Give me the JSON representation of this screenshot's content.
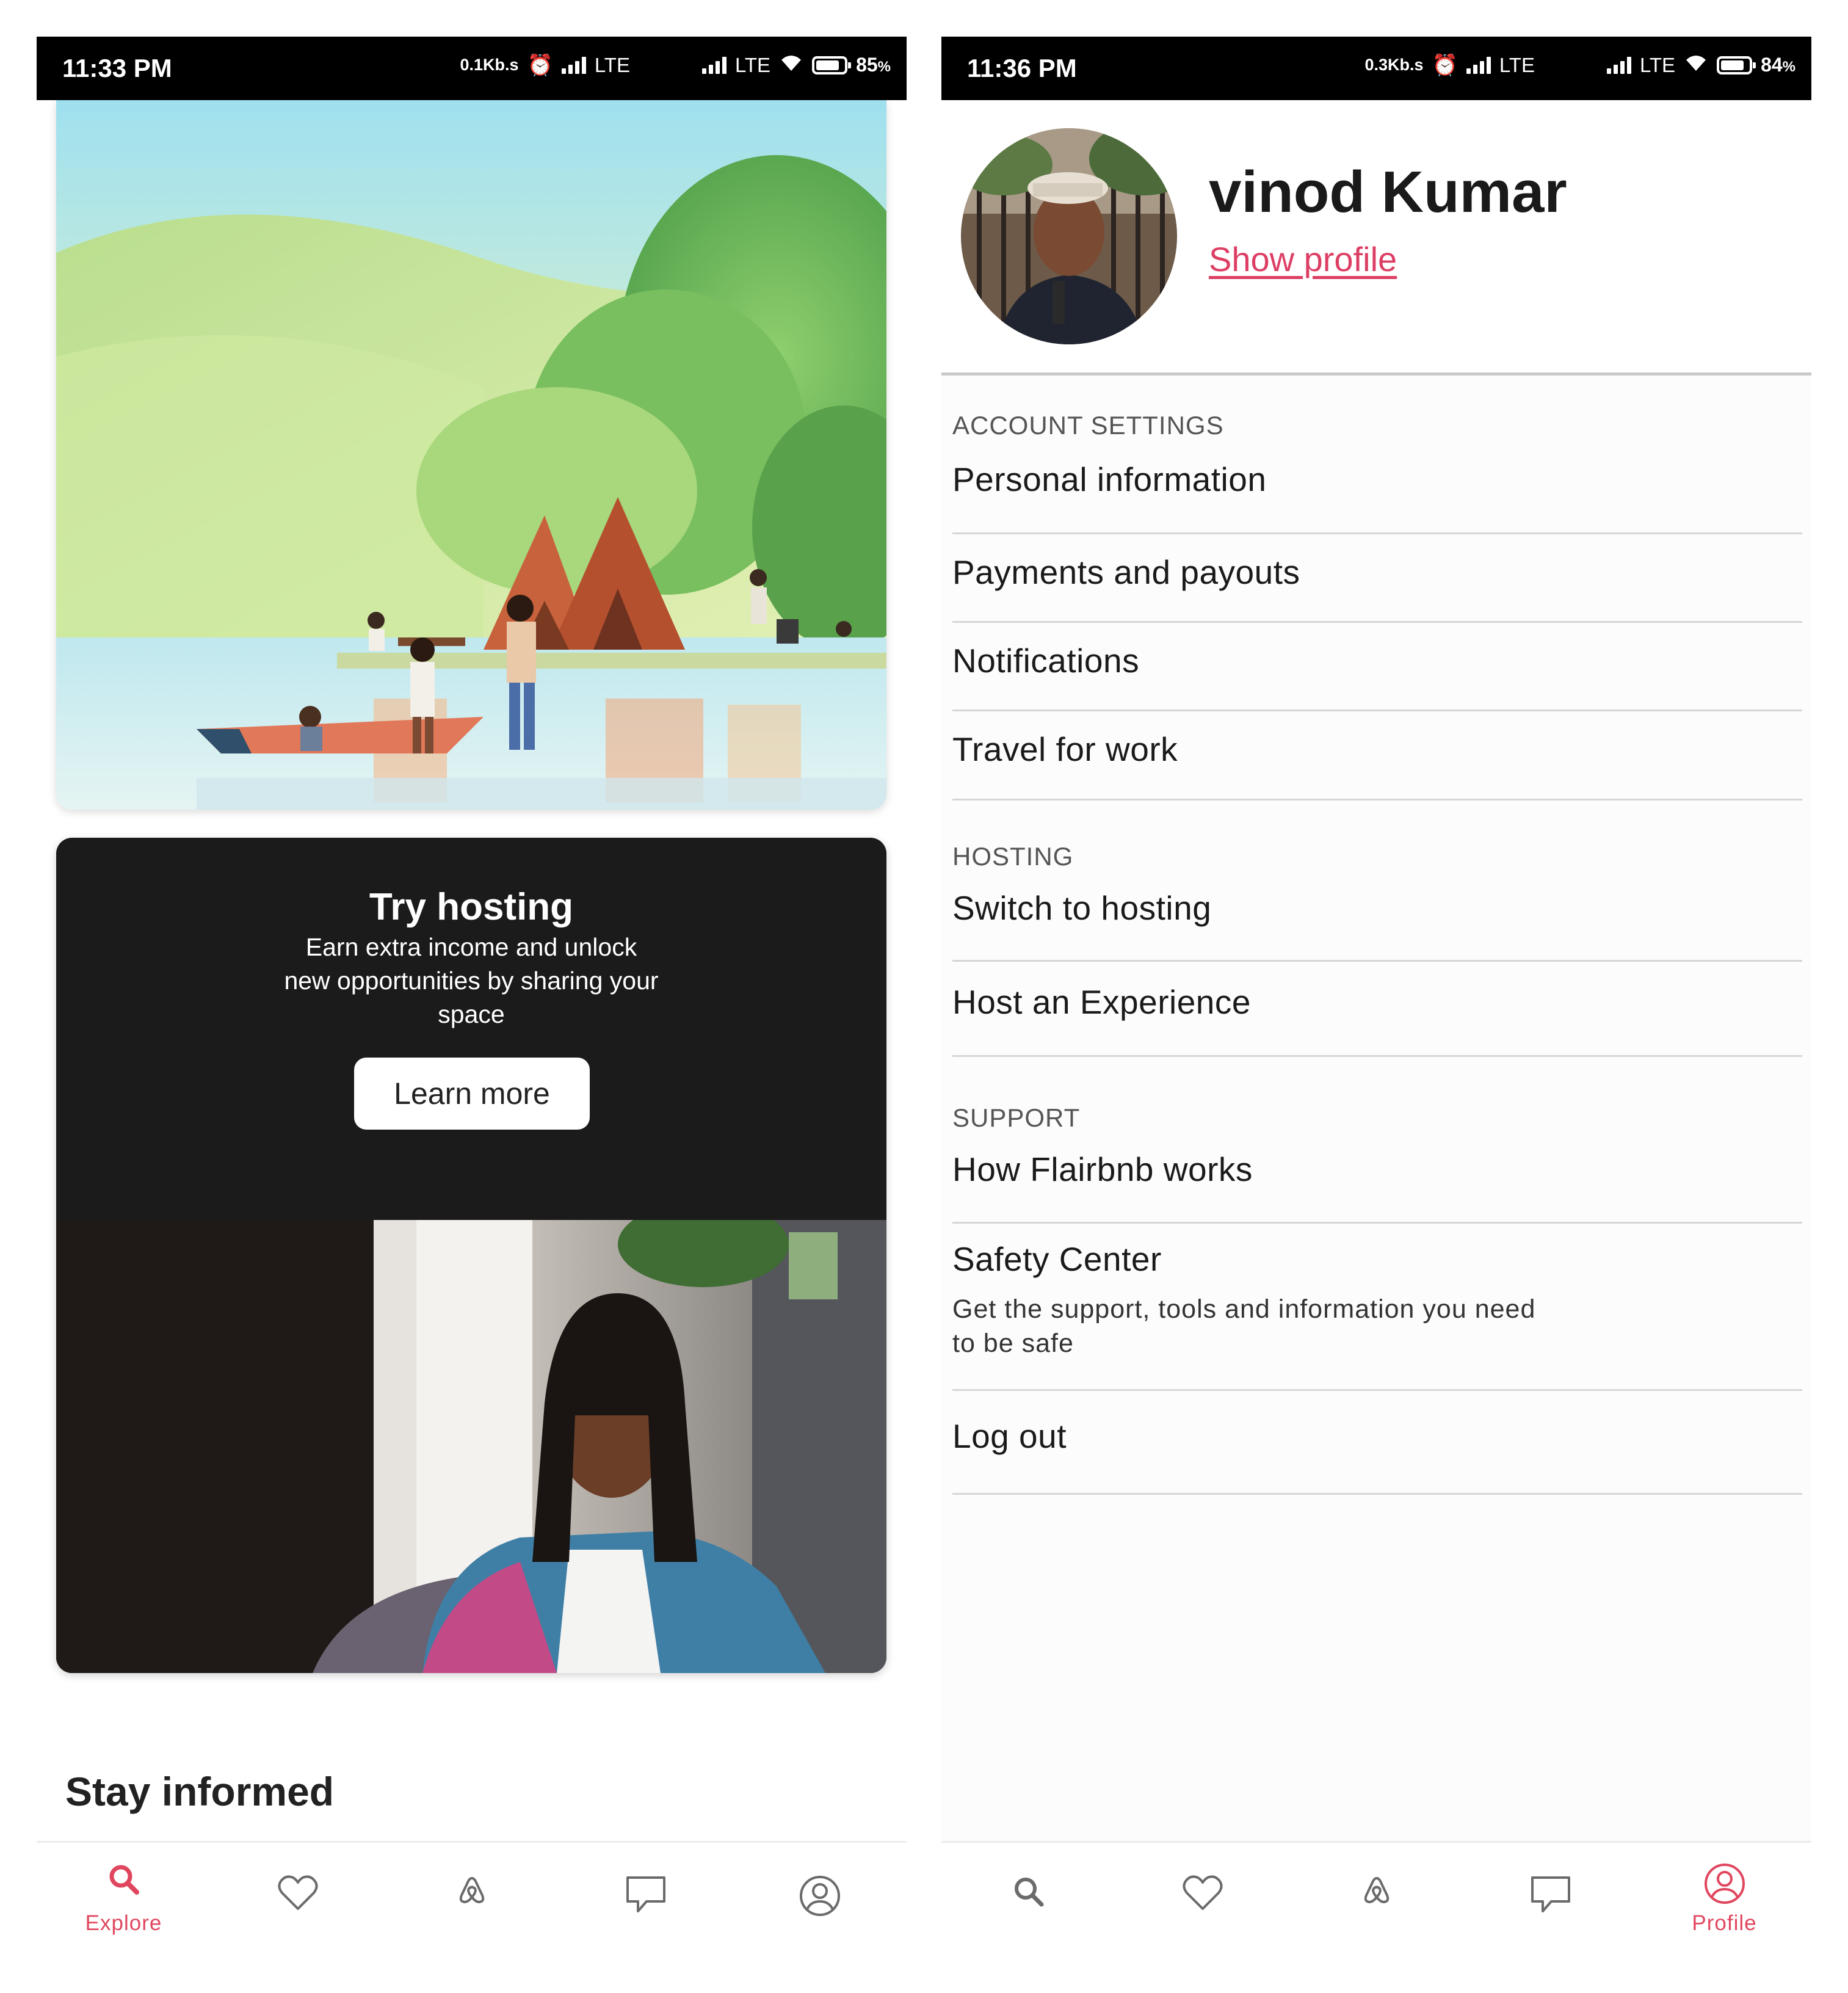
{
  "left_screen": {
    "status_bar": {
      "time": "11:33 PM",
      "net_speed": "0.1Kb.s",
      "network_1": "LTE",
      "network_2": "LTE",
      "battery_percent": "85",
      "battery_suffix": "%",
      "battery_level": 0.85
    },
    "hosting_card": {
      "title": "Try hosting",
      "subtitle": "Earn extra income and unlock new opportunities by sharing your space",
      "button_label": "Learn more"
    },
    "section_title": "Stay informed",
    "bottom_nav": {
      "active": "explore",
      "items": [
        {
          "id": "explore",
          "label": "Explore",
          "icon": "search-icon"
        },
        {
          "id": "wishlists",
          "label": "",
          "icon": "heart-icon"
        },
        {
          "id": "trips",
          "label": "",
          "icon": "airbnb-logo-icon"
        },
        {
          "id": "inbox",
          "label": "",
          "icon": "message-icon"
        },
        {
          "id": "profile",
          "label": "",
          "icon": "user-circle-icon"
        }
      ]
    }
  },
  "right_screen": {
    "status_bar": {
      "time": "11:36 PM",
      "net_speed": "0.3Kb.s",
      "network_1": "LTE",
      "network_2": "LTE",
      "battery_percent": "84",
      "battery_suffix": "%",
      "battery_level": 0.84
    },
    "profile": {
      "name": "vinod Kumar",
      "show_profile_link": "Show profile"
    },
    "sections": [
      {
        "header": "ACCOUNT SETTINGS",
        "items": [
          {
            "label": "Personal information"
          },
          {
            "label": "Payments and payouts"
          },
          {
            "label": "Notifications"
          },
          {
            "label": "Travel for work"
          }
        ]
      },
      {
        "header": "HOSTING",
        "items": [
          {
            "label": "Switch to hosting"
          },
          {
            "label": "Host an Experience"
          }
        ]
      },
      {
        "header": "SUPPORT",
        "items": [
          {
            "label": "How Flairbnb works"
          },
          {
            "label": "Safety Center",
            "description": "Get the support, tools and information you need to be safe"
          },
          {
            "label": "Log out"
          }
        ]
      }
    ],
    "bottom_nav": {
      "active": "profile",
      "items": [
        {
          "id": "explore",
          "label": "",
          "icon": "search-icon"
        },
        {
          "id": "wishlists",
          "label": "",
          "icon": "heart-icon"
        },
        {
          "id": "trips",
          "label": "",
          "icon": "airbnb-logo-icon"
        },
        {
          "id": "inbox",
          "label": "",
          "icon": "message-icon"
        },
        {
          "id": "profile",
          "label": "Profile",
          "icon": "user-circle-icon"
        }
      ]
    }
  },
  "colors": {
    "accent": "#e0475f",
    "link": "#dd3f64",
    "status_bar": "#000000",
    "hosting_card": "#1c1b1b",
    "icon_gray": "#6b6b6b"
  }
}
